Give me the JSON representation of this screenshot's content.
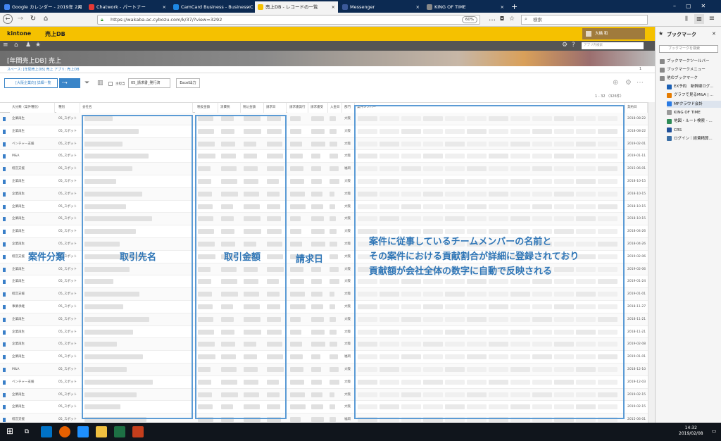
{
  "browser": {
    "tabs": [
      {
        "label": "Google カレンダー - 2019年 2月",
        "color": "#4285f4"
      },
      {
        "label": "Chatwork - パートナー",
        "color": "#e53935"
      },
      {
        "label": "CamCard Business - Business C",
        "color": "#1e88e5"
      },
      {
        "label": "売上DB - レコードの一覧",
        "color": "#f5c100"
      },
      {
        "label": "Messenger",
        "color": "#3b5998"
      },
      {
        "label": "KING OF TIME",
        "color": "#888888"
      }
    ],
    "close_symbol": "×",
    "new_tab_symbol": "+",
    "url": "https://wakaba-ac.cybozu.com/k/37/?view=3292",
    "zoom": "60%",
    "search_placeholder": "検索",
    "menu_symbol": "…"
  },
  "kintone": {
    "logo": "kintone",
    "app_name": "売上DB",
    "user_name": "大橋 和",
    "search_placeholder": "アプリ内検索",
    "banner_title": "[年間売上DB] 売上",
    "breadcrumb": "スペース: [年間売上DB] 売上   アプリ: 売上DB",
    "view_select": "[大阪企業向] 詳細一覧",
    "filter_select": "05_請求書_発行済",
    "filter_label": "主担当",
    "excel_button": "Excel出力",
    "record_count": "1 - 32 （326件）",
    "page_indicator": "1"
  },
  "table": {
    "headers": [
      "大分類（案件種別）",
      "種別",
      "会社名",
      "税抜金額",
      "消費税",
      "税込金額",
      "請求日",
      "請求書発行",
      "請求書受",
      "入金日",
      "部門",
      "案件メンバー",
      "契約日"
    ],
    "rows": [
      [
        "企業再生",
        "05_スポット",
        "大阪",
        "2018-08-22"
      ],
      [
        "企業再生",
        "05_スポット",
        "大阪",
        "2018-08-22"
      ],
      [
        "ベンチャー支援",
        "05_スポット",
        "大阪",
        "2019-02-01"
      ],
      [
        "M&A",
        "05_スポット",
        "大阪",
        "2019-01-11"
      ],
      [
        "経営支援",
        "05_スポット",
        "福岡",
        "2015-06-01"
      ],
      [
        "企業再生",
        "05_スポット",
        "大阪",
        "2018-10-15"
      ],
      [
        "企業再生",
        "05_スポット",
        "大阪",
        "2018-10-15"
      ],
      [
        "企業再生",
        "05_スポット",
        "大阪",
        "2018-10-15"
      ],
      [
        "企業再生",
        "05_スポット",
        "大阪",
        "2018-10-15"
      ],
      [
        "企業再生",
        "05_スポット",
        "大阪",
        "2018-04-26"
      ],
      [
        "企業再生",
        "05_スポット",
        "大阪",
        "2018-04-26"
      ],
      [
        "経営支援",
        "05_スポット",
        "大阪",
        "2019-02-06"
      ],
      [
        "企業再生",
        "05_スポット",
        "大阪",
        "2019-02-06"
      ],
      [
        "企業再生",
        "05_スポット",
        "大阪",
        "2019-01-24"
      ],
      [
        "経営支援",
        "05_スポット",
        "大阪",
        "2019-01-01"
      ],
      [
        "事業承継",
        "05_スポット",
        "大阪",
        "2018-11-27"
      ],
      [
        "企業再生",
        "05_スポット",
        "大阪",
        "2018-11-21"
      ],
      [
        "企業再生",
        "05_スポット",
        "大阪",
        "2018-11-21"
      ],
      [
        "企業再生",
        "05_スポット",
        "大阪",
        "2019-02-08"
      ],
      [
        "企業再生",
        "05_スポット",
        "福岡",
        "2019-01-01"
      ],
      [
        "M&A",
        "05_スポット",
        "大阪",
        "2018-12-10"
      ],
      [
        "ベンチャー支援",
        "05_スポット",
        "大阪",
        "2019-12-03"
      ],
      [
        "企業再生",
        "05_スポット",
        "大阪",
        "2019-02-15"
      ],
      [
        "企業再生",
        "05_スポット",
        "大阪",
        "2019-02-15"
      ],
      [
        "経営支援",
        "05_スポット",
        "福岡",
        "2015-06-01"
      ]
    ]
  },
  "annotations": {
    "category": "案件分類",
    "client": "取引先名",
    "amount": "取引金額",
    "invoice_date": "請求日",
    "members_line1": "案件に従事しているチームメンバーの名前と",
    "members_line2": "その案件における貢献割合が詳細に登録されており",
    "members_line3": "貢献額が会社全体の数字に自動で反映される"
  },
  "bookmarks": {
    "title": "ブックマーク",
    "search_placeholder": "ブックマークを検索",
    "items": [
      {
        "label": "ブックマークツールバー",
        "icon": "folder-icon"
      },
      {
        "label": "ブックマークメニュー",
        "icon": "folder-icon"
      },
      {
        "label": "他のブックマーク",
        "icon": "folder-icon"
      },
      {
        "label": "EX予約　新幹線ログ...",
        "icon": "ex-icon"
      },
      {
        "label": "グラフで見るM&A | ...",
        "icon": "graph-icon"
      },
      {
        "label": "MFクラウド会計",
        "icon": "mf-icon"
      },
      {
        "label": "KING OF TIME",
        "icon": "clock-icon"
      },
      {
        "label": "地図・ルート検索 - ...",
        "icon": "map-icon"
      },
      {
        "label": "CRS",
        "icon": "crs-icon"
      },
      {
        "label": "ログイン｜経費精算...",
        "icon": "login-icon"
      }
    ]
  },
  "taskbar": {
    "time": "14:32",
    "date": "2019/02/08"
  }
}
